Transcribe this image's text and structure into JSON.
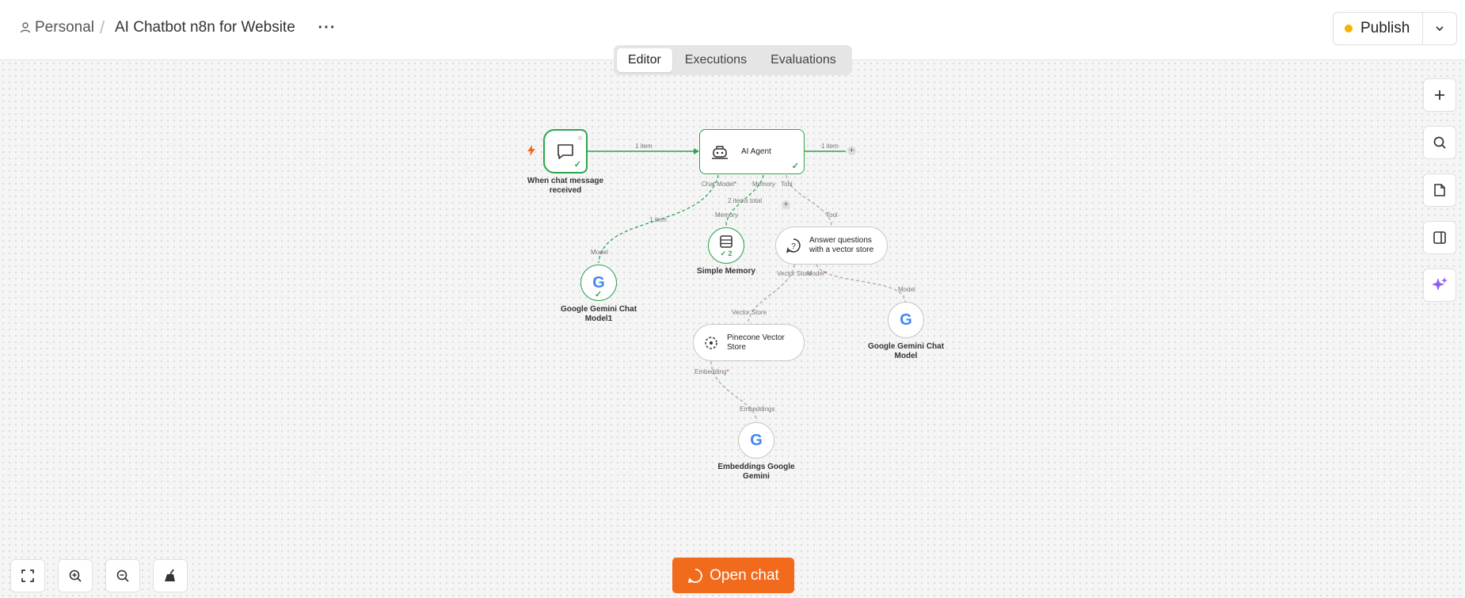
{
  "header": {
    "breadcrumb_personal": "Personal",
    "breadcrumb_separator": "/",
    "workflow_title": "AI Chatbot n8n for Website",
    "more_label": "···",
    "publish_label": "Publish",
    "publish_dot_color": "#f5b400"
  },
  "tabs": [
    {
      "label": "Editor",
      "active": true
    },
    {
      "label": "Executions",
      "active": false
    },
    {
      "label": "Evaluations",
      "active": false
    }
  ],
  "nodes": {
    "chat_trigger": {
      "label": "When chat message received"
    },
    "ai_agent": {
      "label": "AI Agent"
    },
    "gemini_chat_model1": {
      "label": "Google Gemini Chat Model1"
    },
    "simple_memory": {
      "label": "Simple Memory",
      "count": "2"
    },
    "answer_questions": {
      "label": "Answer questions with a vector store"
    },
    "pinecone": {
      "label": "Pinecone Vector Store"
    },
    "gemini_chat_model": {
      "label": "Google Gemini Chat Model"
    },
    "embeddings": {
      "label": "Embeddings Google Gemini"
    }
  },
  "ports": {
    "chat_model": "Chat Model",
    "memory": "Memory",
    "tool": "Tool",
    "model": "Model",
    "memory_in": "Memory",
    "tool_in": "Tool",
    "vector_store": "Vector Store",
    "model2": "Model",
    "vector_store_in": "Vector Store",
    "model_in": "Model",
    "embedding": "Embedding",
    "embeddings_in": "Embeddings",
    "required_mark": "*"
  },
  "edges": {
    "trigger_to_agent": "1 item",
    "agent_out": "1 item",
    "chatmodel_items": "1 item",
    "memory_items": "2 items total"
  },
  "open_chat_label": "Open chat",
  "colors": {
    "success": "#2ea44f",
    "accent_orange": "#f26b1d",
    "ai_purple": "#8b5cf6"
  }
}
